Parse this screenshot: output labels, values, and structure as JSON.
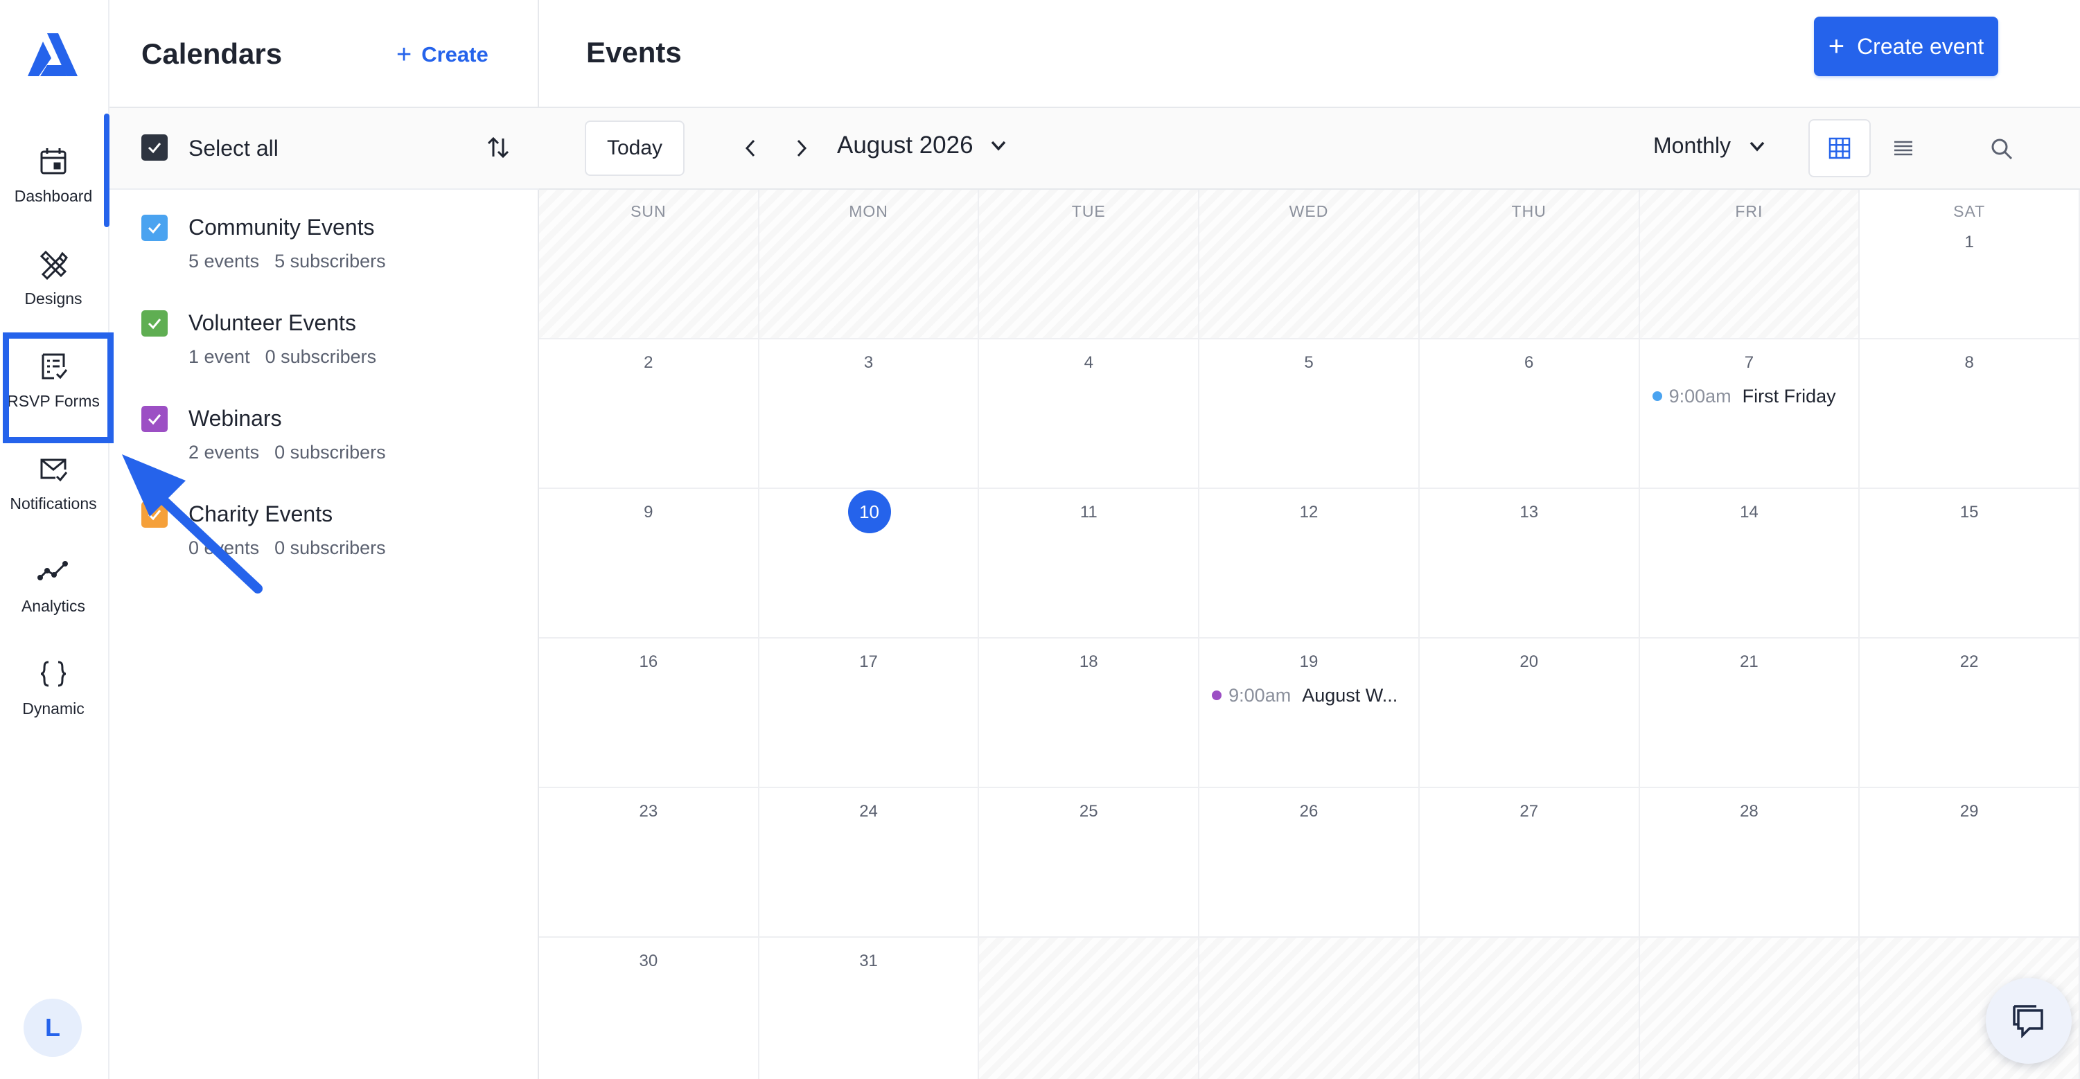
{
  "rail": {
    "items": [
      {
        "label": "Dashboard",
        "icon": "calendar-icon"
      },
      {
        "label": "Designs",
        "icon": "design-tools-icon"
      },
      {
        "label": "RSVP Forms",
        "icon": "rsvp-form-icon"
      },
      {
        "label": "Notifications",
        "icon": "mail-check-icon"
      },
      {
        "label": "Analytics",
        "icon": "analytics-icon"
      },
      {
        "label": "Dynamic",
        "icon": "braces-icon"
      }
    ],
    "avatar_initial": "L"
  },
  "calendars": {
    "title": "Calendars",
    "create_label": "Create",
    "select_all_label": "Select all",
    "items": [
      {
        "name": "Community Events",
        "events": "5 events",
        "subscribers": "5 subscribers",
        "color": "#4aa3f0"
      },
      {
        "name": "Volunteer Events",
        "events": "1 event",
        "subscribers": "0 subscribers",
        "color": "#5fae52"
      },
      {
        "name": "Webinars",
        "events": "2 events",
        "subscribers": "0 subscribers",
        "color": "#9c4fc4"
      },
      {
        "name": "Charity Events",
        "events": "0 events",
        "subscribers": "0 subscribers",
        "color": "#f5a03a"
      }
    ]
  },
  "main": {
    "title": "Events",
    "create_event_label": "Create event",
    "toolbar": {
      "today_label": "Today",
      "month_label": "August 2026",
      "view_label": "Monthly"
    },
    "weekdays": [
      "SUN",
      "MON",
      "TUE",
      "WED",
      "THU",
      "FRI",
      "SAT"
    ],
    "weeks": [
      [
        "",
        "",
        "",
        "",
        "",
        "",
        "1"
      ],
      [
        "2",
        "3",
        "4",
        "5",
        "6",
        "7",
        "8"
      ],
      [
        "9",
        "10",
        "11",
        "12",
        "13",
        "14",
        "15"
      ],
      [
        "16",
        "17",
        "18",
        "19",
        "20",
        "21",
        "22"
      ],
      [
        "23",
        "24",
        "25",
        "26",
        "27",
        "28",
        "29"
      ],
      [
        "30",
        "31",
        "",
        "",
        "",
        "",
        ""
      ]
    ],
    "today_day": "10",
    "events": [
      {
        "day": "7",
        "time": "9:00am",
        "name": "First Friday",
        "color": "#4aa3f0"
      },
      {
        "day": "19",
        "time": "9:00am",
        "name": "August W...",
        "color": "#9c4fc4"
      }
    ]
  },
  "colors": {
    "accent": "#2563eb"
  }
}
